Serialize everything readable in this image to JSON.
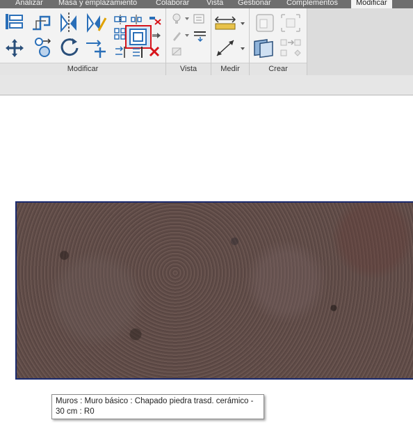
{
  "ribbon": {
    "tabs": [
      "Analizar",
      "Masa y emplazamiento",
      "Colaborar",
      "Vista",
      "Gestionar",
      "Complementos",
      "Modificar"
    ],
    "active_tab": "Modificar",
    "panels": {
      "modificar": "Modificar",
      "vista": "Vista",
      "medir": "Medir",
      "crear": "Crear"
    },
    "selected_tool": "offset-tool",
    "highlight_color": "#d7141a"
  },
  "canvas": {
    "element": "wall-texture",
    "tooltip_line1": "Muros : Muro básico : Chapado piedra trasd. cerámico -",
    "tooltip_line2": "30 cm : R0"
  }
}
